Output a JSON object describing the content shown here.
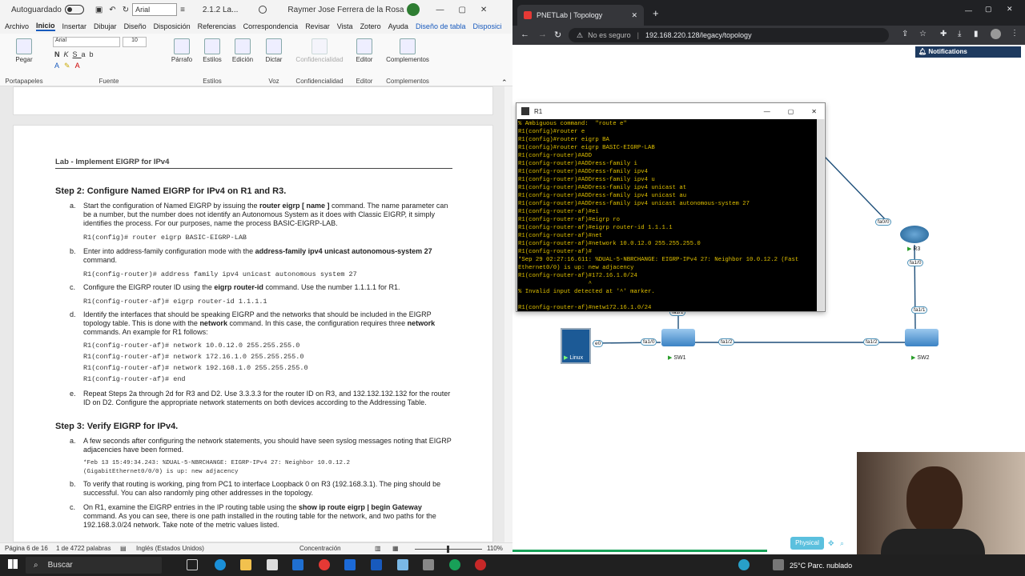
{
  "word": {
    "title_left": "Autoguardado",
    "font_name": "Arial",
    "doc_name": "2.1.2 La...",
    "user": "Raymer Jose Ferrera de la Rosa",
    "menu": [
      "Archivo",
      "Inicio",
      "Insertar",
      "Dibujar",
      "Diseño",
      "Disposición",
      "Referencias",
      "Correspondencia",
      "Revisar",
      "Vista",
      "Zotero",
      "Ayuda",
      "Diseño de tabla",
      "Disposici"
    ],
    "ribbon": {
      "paste": "Pegar",
      "clipboard": "Portapapeles",
      "font_size": "10",
      "font_group": "Fuente",
      "paragraph": "Párrafo",
      "styles": "Estilos",
      "editing": "Edición",
      "dictate": "Dictar",
      "voice": "Voz",
      "sensitivity": "Confidencialidad",
      "editor": "Editor",
      "addins": "Complementos"
    },
    "status": {
      "page": "Página 6 de 16",
      "words": "1 de 4722 palabras",
      "lang": "Inglés (Estados Unidos)",
      "focus": "Concentración",
      "zoom": "110%"
    },
    "doc": {
      "lab_title": "Lab - Implement EIGRP for IPv4",
      "step2": "Step 2: Configure Named EIGRP for IPv4 on R1 and R3.",
      "a_letter": "a.",
      "a_text1": "Start the configuration of Named EIGRP by issuing the ",
      "a_cmd": "router eigrp [ name ]",
      "a_text2": " command. The name parameter can be a number, but the number does not identify an Autonomous System as it does with Classic EIGRP, it simply identifies the process. For our purposes, name the process BASIC-EIGRP-LAB.",
      "a_code": "R1(config)# router eigrp BASIC-EIGRP-LAB",
      "b_letter": "b.",
      "b_text1": "Enter into address-family configuration mode with the ",
      "b_cmd": "address-family ipv4 unicast autonomous-system 27",
      "b_text2": " command.",
      "b_code": "R1(config-router)# address family ipv4 unicast autonomous system 27",
      "c_letter": "c.",
      "c_text1": "Configure the EIGRP router ID using the ",
      "c_cmd": "eigrp router-id",
      "c_text2": " command. Use the number 1.1.1.1 for R1.",
      "c_code": "R1(config-router-af)# eigrp router-id 1.1.1.1",
      "d_letter": "d.",
      "d_text1": "Identify the interfaces that should be speaking EIGRP and the networks that should be included in the EIGRP topology table. This is done with the ",
      "d_cmd": "network",
      "d_text2": " command. In this case, the configuration requires three ",
      "d_cmd2": "network",
      "d_text3": " commands. An example for R1 follows:",
      "d_code": [
        "R1(config-router-af)# network 10.0.12.0 255.255.255.0",
        "R1(config-router-af)# network 172.16.1.0 255.255.255.0",
        "R1(config-router-af)# network 192.168.1.0 255.255.255.0",
        "R1(config-router-af)# end"
      ],
      "e_letter": "e.",
      "e_text": "Repeat Steps 2a through 2d for R3 and D2. Use 3.3.3.3 for the router ID on R3, and 132.132.132.132 for the router ID on D2. Configure the appropriate network statements on both devices according to the Addressing Table.",
      "step3": "Step 3: Verify EIGRP for IPv4.",
      "s3a_letter": "a.",
      "s3a_text": "A few seconds after configuring the network statements, you should have seen syslog messages noting that EIGRP adjacencies have been formed.",
      "s3a_code": [
        "*Feb 13 15:49:34.243: %DUAL-5-NBRCHANGE: EIGRP-IPv4 27: Neighbor 10.0.12.2",
        "(GigabitEthernet0/0/0) is up: new adjacency"
      ],
      "s3b_letter": "b.",
      "s3b_text": "To verify that routing is working, ping from PC1 to interface Loopback 0 on R3 (192.168.3.1). The ping should be successful. You can also randomly ping other addresses in the topology.",
      "s3c_letter": "c.",
      "s3c_text1": "On R1, examine the EIGRP entries in the IP routing table using the ",
      "s3c_cmd": "show ip route eigrp | begin Gateway",
      "s3c_text2": " command. As you can see, there is one path installed in the routing table for the network, and two paths for the 192.168.3.0/24 network. Take note of the metric values listed."
    }
  },
  "chrome": {
    "tab_title": "PNETLab | Topology",
    "not_secure": "No es seguro",
    "url": "192.168.220.128/legacy/topology",
    "notifications": "Notifications",
    "physical": "Physical"
  },
  "terminal": {
    "title": "R1",
    "lines": [
      "% Ambiguous command:  \"route e\"",
      "R1(config)#router e",
      "R1(config)#router eigrp BA",
      "R1(config)#router eigrp BASIC-EIGRP-LAB",
      "R1(config-router)#ADD",
      "R1(config-router)#ADDress-family i",
      "R1(config-router)#ADDress-family ipv4",
      "R1(config-router)#ADDress-family ipv4 u",
      "R1(config-router)#ADDress-family ipv4 unicast at",
      "R1(config-router)#ADDress-family ipv4 unicast au",
      "R1(config-router)#ADDress-family ipv4 unicast autonomous-system 27",
      "R1(config-router-af)#ei",
      "R1(config-router-af)#eigrp ro",
      "R1(config-router-af)#eigrp router-id 1.1.1.1",
      "R1(config-router-af)#net",
      "R1(config-router-af)#network 10.0.12.0 255.255.255.0",
      "R1(config-router-af)#",
      "*Sep 29 02:27:16.611: %DUAL-5-NBRCHANGE: EIGRP-IPv4 27: Neighbor 10.0.12.2 (Fast",
      "Ethernet0/0) is up: new adjacency",
      "R1(config-router-af)#172.16.1.0/24",
      "                    ^",
      "% Invalid input detected at '^' marker.",
      "",
      "R1(config-router-af)#netw172.16.1.0/24"
    ]
  },
  "topology": {
    "r3": "R3",
    "sw1": "SW1",
    "sw2": "SW2",
    "linux": "Linux",
    "ifaces": {
      "fa00": "fa0/0",
      "r3fa10": "fa1/0",
      "fa11": "fa1/1",
      "e0": "e0",
      "sw1fa10": "fa1/0",
      "fa12a": "fa1/2",
      "fa12b": "fa1/2",
      "fa1top": "fa1/1"
    }
  },
  "taskbar": {
    "search": "Buscar",
    "weather": "25°C  Parc. nublado"
  }
}
